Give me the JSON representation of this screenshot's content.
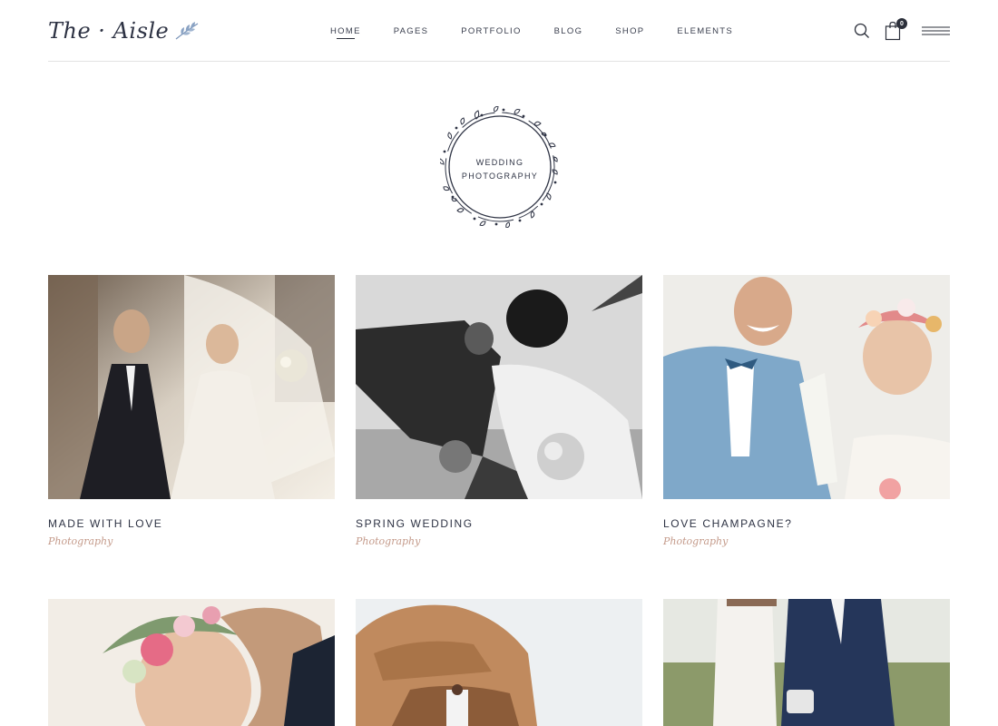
{
  "logo": {
    "text": "The · Aisle"
  },
  "nav": {
    "items": [
      {
        "label": "HOME",
        "active": true
      },
      {
        "label": "PAGES",
        "active": false
      },
      {
        "label": "PORTFOLIO",
        "active": false
      },
      {
        "label": "BLOG",
        "active": false
      },
      {
        "label": "SHOP",
        "active": false
      },
      {
        "label": "ELEMENTS",
        "active": false
      }
    ]
  },
  "header_tools": {
    "search_icon": "search-icon",
    "cart_icon": "shopping-bag-icon",
    "cart_count": "0",
    "menu_icon": "hamburger-menu-icon"
  },
  "badge": {
    "line1": "WEDDING",
    "line2": "PHOTOGRAPHY"
  },
  "portfolio": {
    "items": [
      {
        "title": "MADE WITH LOVE",
        "category": "Photography"
      },
      {
        "title": "SPRING WEDDING",
        "category": "Photography"
      },
      {
        "title": "LOVE CHAMPAGNE?",
        "category": "Photography"
      },
      {
        "title": "",
        "category": ""
      },
      {
        "title": "",
        "category": ""
      },
      {
        "title": "",
        "category": ""
      }
    ]
  },
  "colors": {
    "text": "#2e3344",
    "accent": "#c49a8a",
    "divider": "#e2e2e2"
  }
}
